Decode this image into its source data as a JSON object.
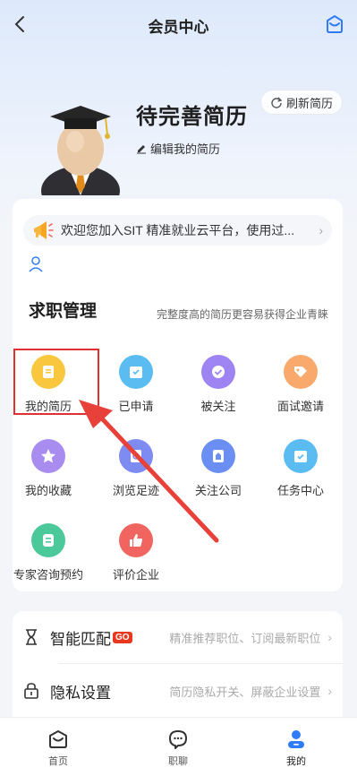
{
  "header": {
    "title": "会员中心"
  },
  "profile": {
    "name": "待完善简历",
    "edit_label": "编辑我的简历",
    "refresh_label": "刷新简历"
  },
  "notice": {
    "text": "欢迎您加入SIT 精准就业云平台，使用过..."
  },
  "section": {
    "title": "求职管理",
    "subtitle": "完整度高的简历更容易获得企业青睐",
    "items": [
      {
        "label": "我的简历",
        "icon": "resume-icon",
        "color": "#f8c73e"
      },
      {
        "label": "已申请",
        "icon": "applied-icon",
        "color": "#5bbcf2"
      },
      {
        "label": "被关注",
        "icon": "followed-icon",
        "color": "#9d84f2"
      },
      {
        "label": "面试邀请",
        "icon": "interview-icon",
        "color": "#f9a96b"
      },
      {
        "label": "我的收藏",
        "icon": "star-icon",
        "color": "#a98cf0"
      },
      {
        "label": "浏览足迹",
        "icon": "footprint-icon",
        "color": "#7e8cf2"
      },
      {
        "label": "关注公司",
        "icon": "company-icon",
        "color": "#6a8ef2"
      },
      {
        "label": "任务中心",
        "icon": "task-icon",
        "color": "#5bbcf2"
      },
      {
        "label": "专家咨询预约",
        "icon": "consult-icon",
        "color": "#4cc99a"
      },
      {
        "label": "评价企业",
        "icon": "thumbs-up-icon",
        "color": "#f0655f"
      }
    ]
  },
  "rows": [
    {
      "label": "智能匹配",
      "badge": "GO",
      "desc": "精准推荐职位、订阅最新职位"
    },
    {
      "label": "隐私设置",
      "desc": "简历隐私开关、屏蔽企业设置"
    }
  ],
  "tabbar": {
    "tabs": [
      {
        "label": "首页"
      },
      {
        "label": "职聊"
      },
      {
        "label": "我的"
      }
    ]
  },
  "colors": {
    "accent": "#2f7cf6",
    "highlight": "#e03131"
  }
}
